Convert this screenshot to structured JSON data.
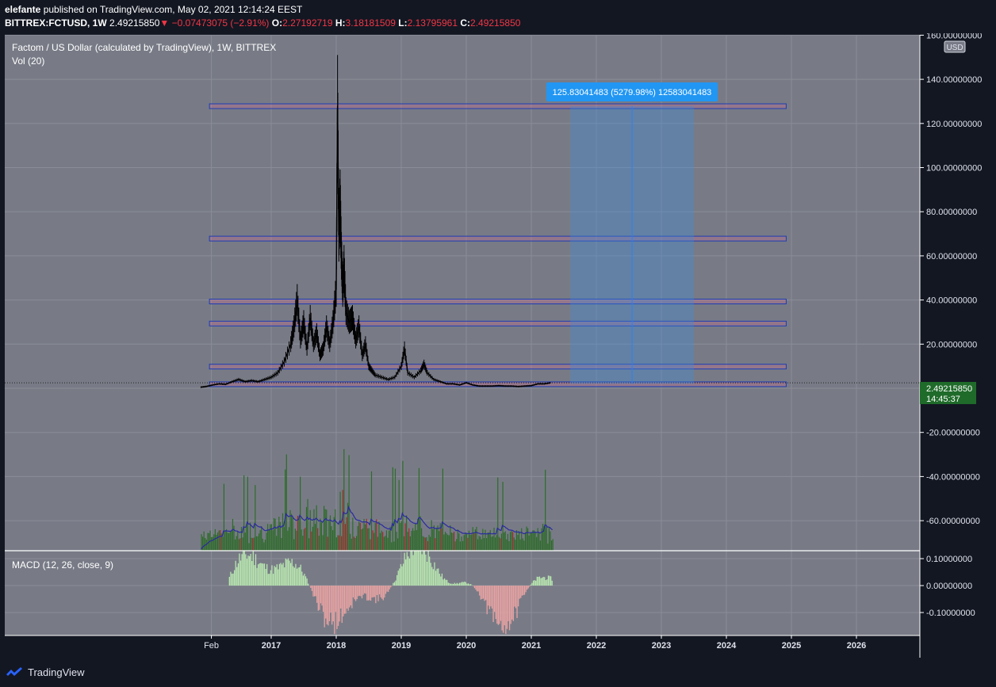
{
  "header": {
    "publisher": "elefante",
    "published_text": "published on TradingView.com, May 02, 2021 12:14:24 EEST",
    "symbol": "BITTREX:FCTUSD, 1W",
    "last": "2.49215850",
    "change": "−0.07473075 (−2.91%)",
    "o_label": "O:",
    "o": "2.27192719",
    "h_label": "H:",
    "h": "3.18181509",
    "l_label": "L:",
    "l": "2.13795961",
    "c_label": "C:",
    "c": "2.49215850"
  },
  "legend": {
    "title": "Factom / US Dollar (calculated by TradingView), 1W, BITTREX",
    "vol": "Vol (20)",
    "macd": "MACD (12, 26, close, 9)"
  },
  "currency": "USD",
  "price_tag": {
    "value": "2.49215850",
    "countdown": "14:45:37"
  },
  "measure_label": "125.83041483 (5279.98%) 12583041483",
  "footer": {
    "brand": "TradingView"
  },
  "colors": {
    "bg": "#787b86",
    "up": "#26a69a",
    "down": "#ef5350",
    "box": "#1e3cb4",
    "tag": "#1f6b2a"
  },
  "chart_data": {
    "type": "line",
    "price_axis": {
      "ticks": [
        160,
        140,
        120,
        100,
        80,
        60,
        40,
        20,
        -20,
        -40,
        -60
      ],
      "tick_labels": [
        "160.00000000",
        "140.00000000",
        "120.00000000",
        "100.00000000",
        "80.00000000",
        "60.00000000",
        "40.00000000",
        "20.00000000",
        "-20.00000000",
        "-40.00000000",
        "-60.00000000"
      ],
      "range": [
        -73,
        162
      ]
    },
    "macd_axis": {
      "ticks": [
        0.1,
        0.0,
        -0.1
      ],
      "tick_labels": [
        "0.10000000",
        "0.00000000",
        "-0.10000000"
      ]
    },
    "time_axis": {
      "labels": [
        "Feb",
        "2017",
        "2018",
        "2019",
        "2020",
        "2021",
        "2022",
        "2023",
        "2024",
        "2025",
        "2026"
      ],
      "years": [
        2016.08,
        2017,
        2018,
        2019,
        2020,
        2021,
        2022,
        2023,
        2024,
        2025,
        2026
      ]
    },
    "price_series": {
      "name": "FCTUSD",
      "x": [
        2015.92,
        2016.0,
        2016.1,
        2016.2,
        2016.3,
        2016.4,
        2016.5,
        2016.6,
        2016.7,
        2016.8,
        2016.9,
        2017.0,
        2017.1,
        2017.2,
        2017.3,
        2017.35,
        2017.4,
        2017.45,
        2017.5,
        2017.55,
        2017.6,
        2017.65,
        2017.7,
        2017.75,
        2017.8,
        2017.85,
        2017.9,
        2017.95,
        2018.0,
        2018.02,
        2018.04,
        2018.06,
        2018.08,
        2018.1,
        2018.12,
        2018.15,
        2018.2,
        2018.25,
        2018.3,
        2018.35,
        2018.4,
        2018.45,
        2018.5,
        2018.55,
        2018.6,
        2018.7,
        2018.8,
        2018.9,
        2019.0,
        2019.05,
        2019.1,
        2019.2,
        2019.3,
        2019.35,
        2019.4,
        2019.5,
        2019.6,
        2019.7,
        2019.8,
        2019.9,
        2020.0,
        2020.1,
        2020.2,
        2020.3,
        2020.4,
        2020.5,
        2020.6,
        2020.7,
        2020.8,
        2020.9,
        2021.0,
        2021.1,
        2021.2,
        2021.3
      ],
      "values": [
        0.5,
        0.8,
        1.5,
        2.0,
        1.8,
        3.0,
        4.0,
        3.0,
        3.5,
        3.0,
        4.0,
        5.0,
        7.0,
        12.0,
        20.0,
        28.0,
        40.0,
        22.0,
        30.0,
        18.0,
        32.0,
        20.0,
        25.0,
        15.0,
        18.0,
        28.0,
        20.0,
        30.0,
        45.0,
        128.0,
        70.0,
        84.0,
        60.0,
        45.0,
        55.0,
        35.0,
        30.0,
        32.0,
        22.0,
        28.0,
        15.0,
        20.0,
        10.0,
        8.0,
        6.0,
        5.0,
        4.0,
        5.0,
        10.0,
        18.0,
        7.0,
        5.0,
        8.0,
        11.0,
        7.0,
        4.0,
        3.0,
        2.0,
        2.0,
        1.5,
        2.5,
        1.5,
        1.0,
        1.0,
        1.0,
        1.2,
        1.0,
        1.0,
        0.8,
        1.0,
        1.2,
        2.0,
        2.0,
        2.5
      ]
    },
    "hlines": [
      128,
      68,
      39.5,
      29.5,
      10,
      2.0
    ],
    "measure": {
      "x_start": 2021.6,
      "x_end": 2023.5,
      "y_start": 2.0,
      "y_end": 127.8
    }
  }
}
